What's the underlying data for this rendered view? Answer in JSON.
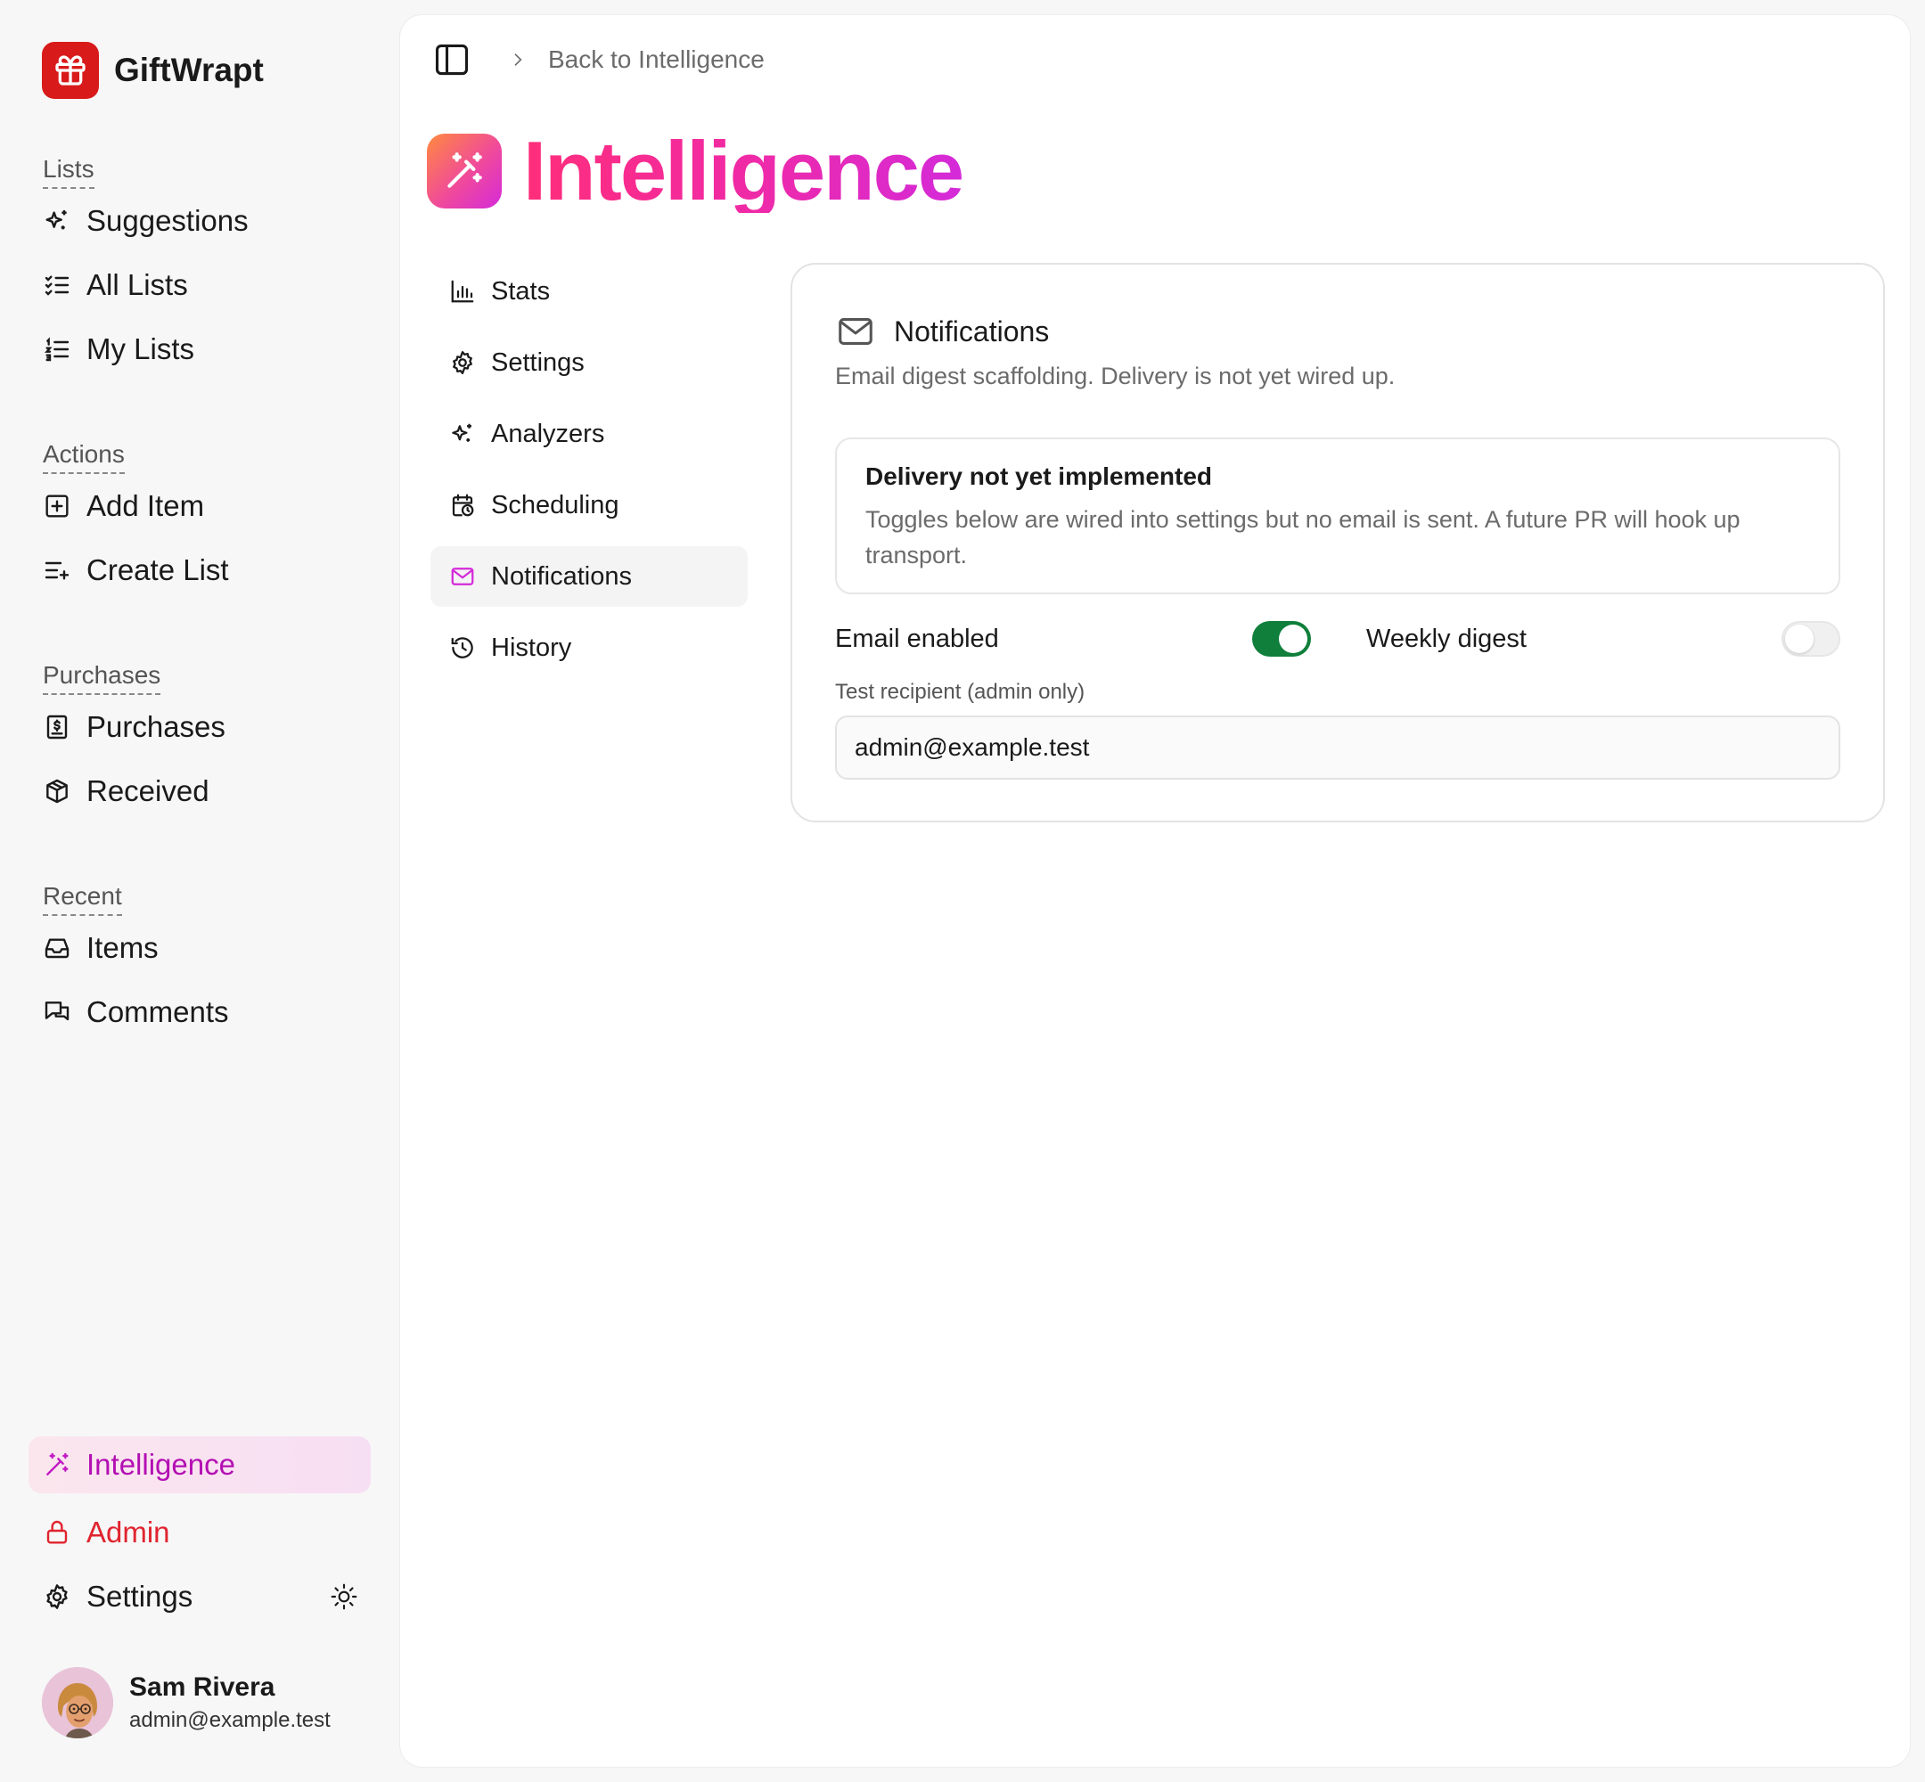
{
  "app": {
    "name": "GiftWrapt",
    "brand_color": "#d81a1a",
    "accent_color": "#d42ad9",
    "toggle_on_color": "#0f7f3b"
  },
  "sidebar": {
    "sections": [
      {
        "label": "Lists",
        "items": [
          {
            "label": "Suggestions",
            "icon": "sparkles-icon"
          },
          {
            "label": "All Lists",
            "icon": "list-checks-icon"
          },
          {
            "label": "My Lists",
            "icon": "list-ordered-icon"
          }
        ]
      },
      {
        "label": "Actions",
        "items": [
          {
            "label": "Add Item",
            "icon": "square-plus-icon"
          },
          {
            "label": "Create List",
            "icon": "list-plus-icon"
          }
        ]
      },
      {
        "label": "Purchases",
        "items": [
          {
            "label": "Purchases",
            "icon": "receipt-icon"
          },
          {
            "label": "Received",
            "icon": "package-icon"
          }
        ]
      },
      {
        "label": "Recent",
        "items": [
          {
            "label": "Items",
            "icon": "inbox-icon"
          },
          {
            "label": "Comments",
            "icon": "messages-icon"
          }
        ]
      }
    ],
    "bottom": [
      {
        "label": "Intelligence",
        "icon": "wand-icon",
        "active": true
      },
      {
        "label": "Admin",
        "icon": "lock-icon"
      },
      {
        "label": "Settings",
        "icon": "gear-icon"
      }
    ],
    "theme_toggle_icon": "sun-icon",
    "user": {
      "name": "Sam Rivera",
      "email": "admin@example.test"
    }
  },
  "topbar": {
    "sidebar_toggle_icon": "panel-left-icon",
    "breadcrumb": "Back to Intelligence"
  },
  "page": {
    "title": "Intelligence",
    "icon": "wand-icon"
  },
  "subnav": [
    {
      "label": "Stats",
      "icon": "bar-chart-icon"
    },
    {
      "label": "Settings",
      "icon": "gear-icon"
    },
    {
      "label": "Analyzers",
      "icon": "sparkles-icon"
    },
    {
      "label": "Scheduling",
      "icon": "calendar-clock-icon"
    },
    {
      "label": "Notifications",
      "icon": "mail-icon",
      "active": true
    },
    {
      "label": "History",
      "icon": "history-icon"
    }
  ],
  "card": {
    "title": "Notifications",
    "description": "Email digest scaffolding. Delivery is not yet wired up.",
    "notice": {
      "title": "Delivery not yet implemented",
      "body": "Toggles below are wired into settings but no email is sent. A future PR will hook up transport."
    },
    "email_enabled": {
      "label": "Email enabled",
      "on": true
    },
    "weekly_digest": {
      "label": "Weekly digest",
      "on": false
    },
    "test_recipient": {
      "label": "Test recipient (admin only)",
      "value": "admin@example.test"
    }
  }
}
